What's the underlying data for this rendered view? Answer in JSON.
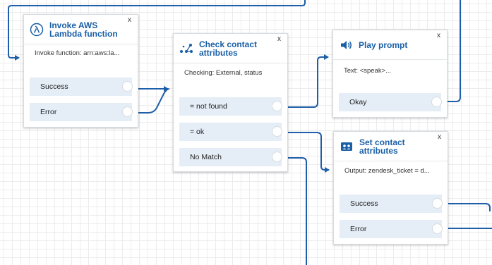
{
  "colors": {
    "accent": "#1a5fa6",
    "connector": "#1f5ea8",
    "branch_bg": "#e5eef7",
    "grid": "#ececec"
  },
  "blocks": {
    "lambda": {
      "title": "Invoke AWS Lambda function",
      "icon": "lambda-icon",
      "description": "Invoke function: arn:aws:la...",
      "close": "x",
      "branches": [
        {
          "label": "Success"
        },
        {
          "label": "Error"
        }
      ]
    },
    "check": {
      "title": "Check contact attributes",
      "icon": "check-attributes-icon",
      "description": "Checking: External, status",
      "close": "x",
      "branches": [
        {
          "label": "= not found"
        },
        {
          "label": "= ok"
        },
        {
          "label": "No Match"
        }
      ]
    },
    "play": {
      "title": "Play prompt",
      "icon": "speaker-icon",
      "description": "Text: <speak>...",
      "close": "x",
      "branches": [
        {
          "label": "Okay"
        }
      ]
    },
    "set": {
      "title": "Set contact attributes",
      "icon": "set-attributes-icon",
      "description": "Output: zendesk_ticket = d...",
      "close": "x",
      "branches": [
        {
          "label": "Success"
        },
        {
          "label": "Error"
        }
      ]
    }
  }
}
